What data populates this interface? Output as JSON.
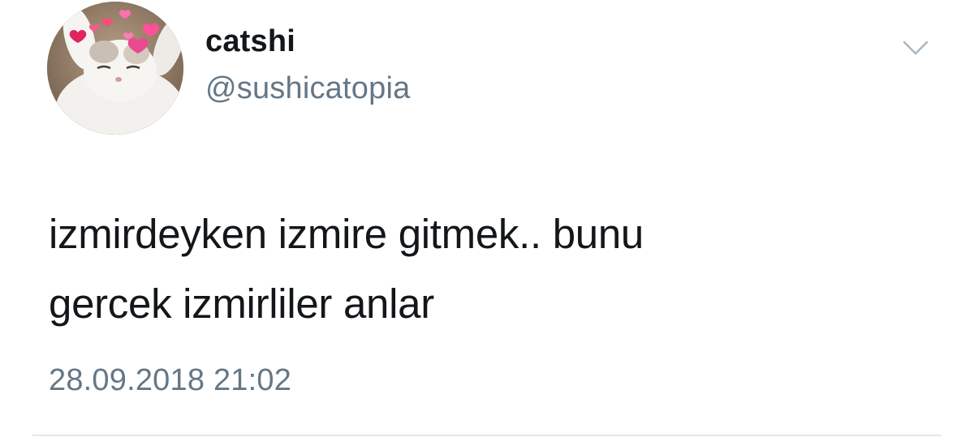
{
  "author": {
    "display_name": "catshi",
    "handle": "@sushicatopia",
    "avatar_icon": "cat-with-hearts-avatar"
  },
  "tweet": {
    "lines": [
      "izmirdeyken izmire gitmek.. bunu",
      "gercek izmirliler anlar"
    ],
    "timestamp": "28.09.2018 21:02"
  },
  "menu": {
    "icon": "chevron-down-icon"
  },
  "colors": {
    "text_primary": "#14171a",
    "text_secondary": "#657786",
    "divider": "#e1e8ed",
    "chevron": "#aab8c2",
    "hearts": "#e0245e"
  }
}
